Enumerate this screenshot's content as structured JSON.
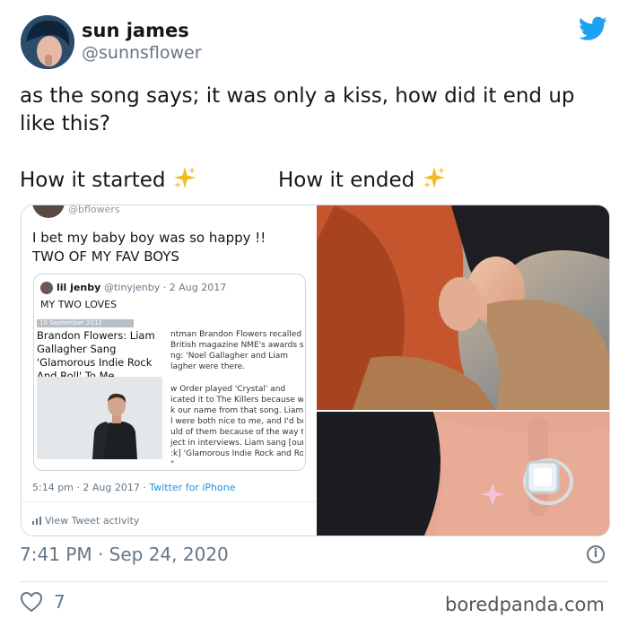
{
  "user": {
    "name": "sun james",
    "handle": "@sunnsflower"
  },
  "tweet": {
    "text": "as the song says; it was only a kiss, how did it end up like this?",
    "label_left": "How it started",
    "label_right": "How it ended",
    "timestamp": "7:41 PM · Sep 24, 2020",
    "likes": "7"
  },
  "embedded": {
    "top_handle": "@bflowers",
    "text": "I bet my baby boy was so happy !! TWO OF MY FAV BOYS",
    "quote": {
      "name": "lil jenby",
      "handle": "@tinyjenby · 2 Aug 2017",
      "text": "MY TWO LOVES",
      "article_tag": "10 September 2012",
      "headline": "Brandon Flowers: Liam Gallagher Sang 'Glamorous Indie Rock And Roll' To Me",
      "snippet_top": "ntman Brandon Flowers recalled be\nBritish magazine NME's awards show\nng: 'Noel Gallagher and Liam\nlagher were there.",
      "snippet_bottom": "w Order played 'Crystal' and\nicated it to The Killers because we\nk our name from that song. Liam ar\nl were both nice to me, and I'd bee\nuld of them because of the way the\nject in interviews. Liam sang [our\n:k] 'Glamorous Indie Rock and Roll'\n\""
    },
    "meta_time": "5:14 pm · 2 Aug 2017 · ",
    "meta_source": "Twitter for iPhone",
    "activity": "View Tweet activity"
  },
  "brand": "boredpanda.com",
  "colors": {
    "twitter_blue": "#1da1f2",
    "secondary_text": "#657786",
    "border": "#ccd6dd"
  },
  "icons": [
    "twitter-bird-icon",
    "sparkles-icon",
    "info-icon",
    "heart-icon",
    "bar-chart-icon"
  ]
}
